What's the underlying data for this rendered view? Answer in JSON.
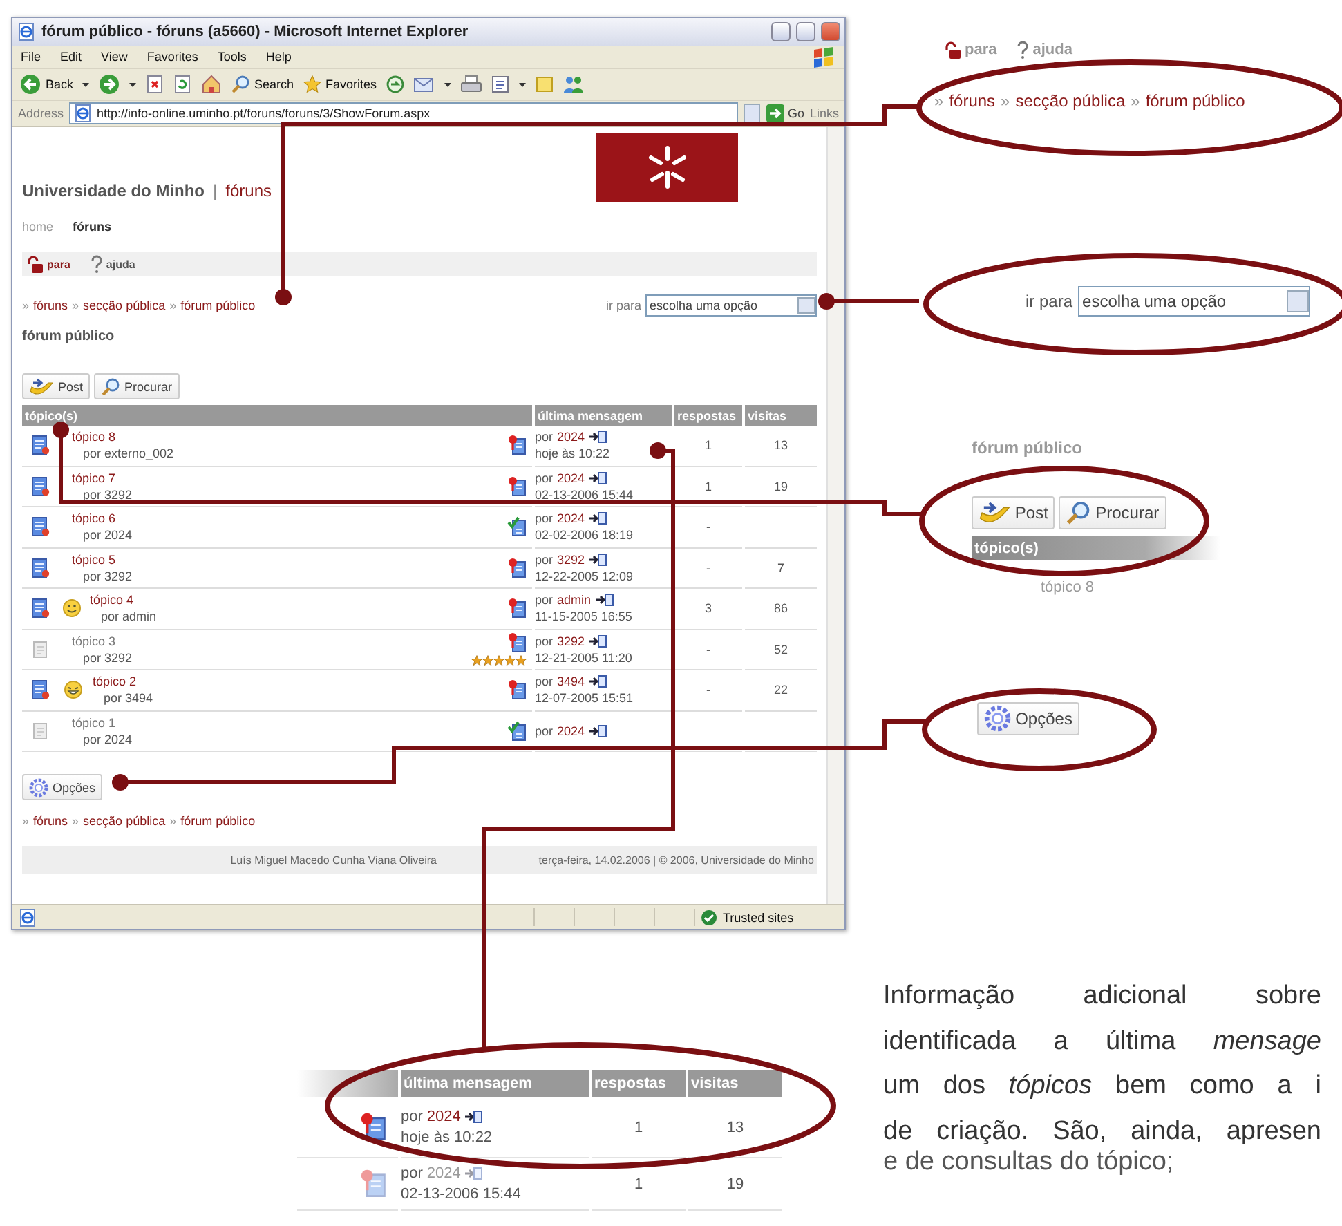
{
  "browser": {
    "title": "fórum público - fóruns (a5660) - Microsoft Internet Explorer",
    "menu": [
      "File",
      "Edit",
      "View",
      "Favorites",
      "Tools",
      "Help"
    ],
    "toolbar": [
      {
        "kind": "back",
        "label": "Back",
        "caret": true
      },
      {
        "kind": "forward",
        "caret": true
      },
      {
        "kind": "stop"
      },
      {
        "kind": "refresh"
      },
      {
        "kind": "home"
      },
      {
        "kind": "search",
        "label": "Search"
      },
      {
        "kind": "favorites",
        "label": "Favorites"
      },
      {
        "kind": "media"
      },
      {
        "kind": "mail",
        "caret": true
      },
      {
        "kind": "print"
      },
      {
        "kind": "edit",
        "caret": true
      },
      {
        "kind": "note"
      },
      {
        "kind": "messenger"
      }
    ],
    "address_label": "Address",
    "url": "http://info-online.uminho.pt/foruns/foruns/3/ShowForum.aspx",
    "go": "Go",
    "links": "Links",
    "status": "Trusted sites"
  },
  "page": {
    "site_name": "Universidade do Minho",
    "divider": "|",
    "site_section": "fóruns",
    "nav": [
      {
        "label": "home",
        "selected": false
      },
      {
        "label": "fóruns",
        "selected": true
      }
    ],
    "tools": [
      {
        "kind": "para",
        "label": "para"
      },
      {
        "kind": "help",
        "label": "ajuda"
      }
    ],
    "breadcrumb": [
      {
        "separator": "»",
        "label": "fóruns"
      },
      {
        "separator": "»",
        "label": "secção pública"
      },
      {
        "separator": "»",
        "label": "fórum público"
      }
    ],
    "jump_label": "ir para",
    "jump_value": "escolha uma opção",
    "heading": "fórum público",
    "buttons": [
      {
        "kind": "post",
        "label": "Post"
      },
      {
        "kind": "search",
        "label": "Procurar"
      }
    ],
    "columns": [
      "tópico(s)",
      "última mensagem",
      "respostas",
      "visitas"
    ],
    "rows": [
      {
        "read": false,
        "title": "tópico 8",
        "author": "por externo_002",
        "status_icon": {
          "kind": "question"
        },
        "last_prefix": "por",
        "last_by": "2024",
        "last_date": "hoje às 10:22",
        "replies": "1",
        "visits": "13"
      },
      {
        "read": false,
        "title": "tópico 7",
        "author": "por 3292",
        "status_icon": {
          "kind": "question"
        },
        "last_prefix": "por",
        "last_by": "2024",
        "last_date": "02-13-2006 15:44",
        "replies": "1",
        "visits": "19"
      },
      {
        "read": false,
        "title": "tópico 6",
        "author": "por 2024",
        "status_icon": {
          "kind": "check"
        },
        "last_prefix": "por",
        "last_by": "2024",
        "last_date": "02-02-2006 18:19",
        "replies": "-"
      },
      {
        "read": false,
        "title": "tópico 5",
        "author": "por 3292",
        "status_icon": {
          "kind": "question"
        },
        "last_prefix": "por",
        "last_by": "3292",
        "last_date": "12-22-2005 12:09",
        "replies": "-",
        "visits": "7"
      },
      {
        "read": false,
        "emoticon": {
          "kind": "smile"
        },
        "title": "tópico 4",
        "author": "por admin",
        "status_icon": {
          "kind": "question"
        },
        "last_prefix": "por",
        "last_by": "admin",
        "last_date": "11-15-2005 16:55",
        "replies": "3",
        "visits": "86"
      },
      {
        "read": true,
        "title": "tópico 3",
        "author": "por 3292",
        "status_icon": {
          "kind": "question"
        },
        "stars": 5,
        "last_prefix": "por",
        "last_by": "3292",
        "last_date": "12-21-2005 11:20",
        "replies": "-",
        "visits": "52"
      },
      {
        "read": false,
        "emoticon": {
          "kind": "laugh"
        },
        "title": "tópico 2",
        "author": "por 3494",
        "status_icon": {
          "kind": "question"
        },
        "last_prefix": "por",
        "last_by": "3494",
        "last_date": "12-07-2005 15:51",
        "replies": "-",
        "visits": "22"
      },
      {
        "read": true,
        "title": "tópico 1",
        "author": "por 2024",
        "status_icon": {
          "kind": "check"
        },
        "last_prefix": "por",
        "last_by": "2024"
      }
    ],
    "options_button": "Opções",
    "breadcrumb_bottom": [
      {
        "separator": "»",
        "label": "fóruns"
      },
      {
        "separator": "»",
        "label": "secção pública"
      },
      {
        "separator": "»",
        "label": "fórum público"
      }
    ],
    "footer_author": "Luís Miguel Macedo Cunha Viana Oliveira",
    "footer_date": "terça-feira, 14.02.2006 | © 2006, Universidade do Minho"
  },
  "callouts": {
    "breadcrumb_zoom": {
      "tools": [
        {
          "kind": "para",
          "label": "para"
        },
        {
          "kind": "help",
          "label": "ajuda"
        }
      ],
      "breadcrumb": [
        {
          "separator": "»",
          "label": "fóruns"
        },
        {
          "separator": "»",
          "label": "secção pública"
        },
        {
          "separator": "»",
          "label": "fórum público"
        }
      ]
    },
    "jump_zoom": {
      "label": "ir para",
      "value": "escolha uma opção"
    },
    "buttons_zoom": {
      "heading": "fórum público",
      "buttons": [
        {
          "kind": "post",
          "label": "Post"
        },
        {
          "kind": "search",
          "label": "Procurar"
        }
      ],
      "column": "tópico(s)",
      "row_title": "tópico 8"
    },
    "options_zoom": {
      "label": "Opções"
    },
    "table_zoom": {
      "columns": [
        "última mensagem",
        "respostas",
        "visitas"
      ],
      "rows": [
        {
          "faded": false,
          "status_icon": {
            "kind": "question"
          },
          "last_prefix": "por",
          "last_by": "2024",
          "last_date": "hoje às 10:22",
          "replies": "1",
          "visits": "13"
        },
        {
          "faded": true,
          "status_icon": {
            "kind": "question"
          },
          "last_prefix": "por",
          "last_by": "2024",
          "last_date": "02-13-2006 15:44",
          "replies": "1",
          "visits": "19"
        }
      ]
    }
  },
  "description": {
    "lines": [
      "Informação adicional sobre",
      "identificada a última *mensage*",
      "um dos *tópicos* bem como a i",
      "de criação. São, ainda, apresen",
      "e de consultas do tópico;"
    ]
  }
}
